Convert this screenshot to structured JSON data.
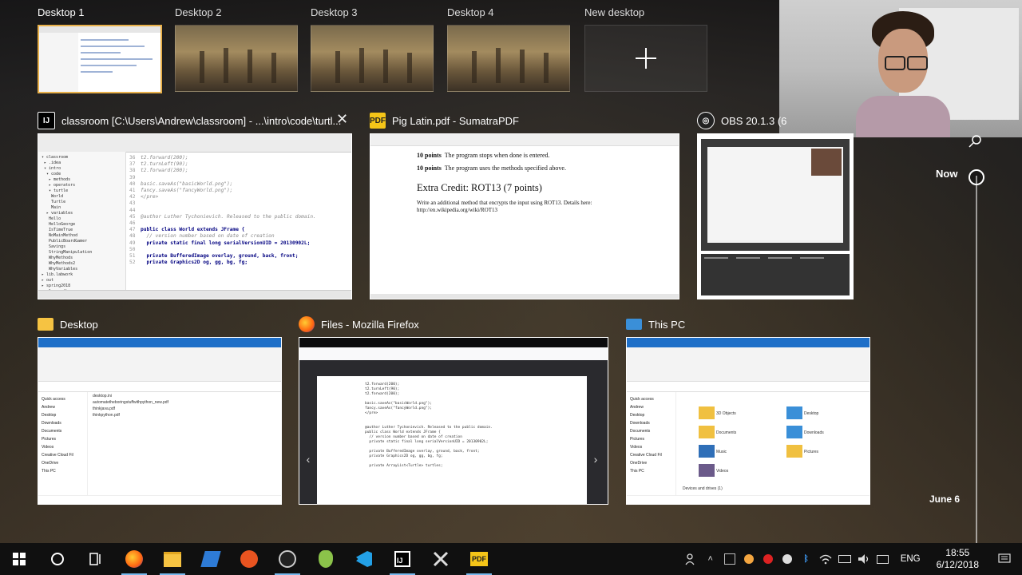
{
  "desktops": [
    {
      "label": "Desktop 1",
      "active": true
    },
    {
      "label": "Desktop 2",
      "active": false
    },
    {
      "label": "Desktop 3",
      "active": false
    },
    {
      "label": "Desktop 4",
      "active": false
    }
  ],
  "new_desktop": {
    "label": "New desktop"
  },
  "windows": {
    "ide": {
      "title": "classroom [C:\\Users\\Andrew\\classroom] - ...\\intro\\code\\turtl...",
      "icon": "intellij-icon",
      "code": {
        "line_numbers": [
          "36",
          "37",
          "38",
          "39",
          "40",
          "41",
          "42",
          "43",
          "44",
          "45",
          "46",
          "47",
          "48",
          "49",
          "50",
          "51",
          "52",
          "53"
        ],
        "lines": [
          "t2.forward(200);",
          "t2.turnLeft(90);",
          "t2.forward(200);",
          "",
          "basic.saveAs(\"basicWorld.png\");",
          "fancy.saveAs(\"fancyWorld.png\");",
          "</pre>",
          "",
          "",
          "@author Luther Tychonievich. Released to the public domain.",
          "",
          "public class World extends JFrame {",
          "  // version number based on date of creation",
          "  private static final long serialVersionUID = 20130902L;",
          "",
          "  private BufferedImage overlay, ground, back, front;",
          "  private Graphics2D og, gg, bg, fg;"
        ]
      }
    },
    "pdf": {
      "title": "Pig Latin.pdf - SumatraPDF",
      "icon": "sumatra-icon",
      "line1_pts": "10 points",
      "line1_text": "The program stops when done is entered.",
      "line2_pts": "10 points",
      "line2_text": "The program uses the methods specified above.",
      "heading": "Extra Credit: ROT13 (7 points)",
      "body": "Write an additional method that encrypts the input using ROT13. Details here: http://en.wikipedia.org/wiki/ROT13"
    },
    "obs": {
      "title": "OBS 20.1.3 (6",
      "icon": "obs-icon"
    },
    "desktop_explorer": {
      "title": "Desktop",
      "icon": "folder-icon",
      "nav": [
        "Quick access",
        "Andrew",
        "Desktop",
        "Downloads",
        "Documents",
        "Pictures",
        "Videos",
        "Creative Cloud Fil",
        "OneDrive",
        "This PC"
      ],
      "files": [
        "desktop.ini",
        "automatetheboringstuffwithpython_new.pdf",
        "thinkjava.pdf",
        "thinkpython.pdf"
      ]
    },
    "firefox": {
      "title": "Files - Mozilla Firefox",
      "icon": "firefox-icon",
      "code_lines": [
        "t2.forward(200);",
        "t2.turnLeft(90);",
        "t2.forward(200);",
        "",
        "basic.saveAs(\"basicWorld.png\");",
        "fancy.saveAs(\"fancyWorld.png\");",
        "</pre>",
        "",
        "",
        "@author Luther Tychonievich. Released to the public domain.",
        "public class World extends JFrame {",
        "  // version number based on date of creation",
        "  private static final long serialVersionUID = 20130902L;",
        "",
        "  private BufferedImage overlay, ground, back, front;",
        "  private Graphics2D og, gg, bg, fg;",
        "",
        "  private ArrayList<Turtle> turtles;"
      ]
    },
    "thispc": {
      "title": "This PC",
      "icon": "this-pc-icon",
      "nav": [
        "Quick access",
        "Andrew",
        "Desktop",
        "Downloads",
        "Documents",
        "Pictures",
        "Videos",
        "Creative Cloud Fil",
        "OneDrive",
        "This PC"
      ],
      "folders": [
        "3D Objects",
        "Desktop",
        "Documents",
        "Downloads",
        "Music",
        "Pictures",
        "Videos"
      ],
      "devices_header": "Devices and drives (1)"
    }
  },
  "timeline": {
    "now_label": "Now",
    "date_label": "June 6"
  },
  "taskbar": {
    "apps": [
      "windows-start-icon",
      "cortana-icon",
      "task-view-icon",
      "firefox-icon",
      "file-explorer-icon",
      "visual-studio-icon",
      "ubuntu-icon",
      "obs-icon",
      "android-studio-icon",
      "vscode-icon",
      "intellij-icon",
      "x-icon",
      "sumatra-icon"
    ],
    "language": "ENG",
    "time": "18:55",
    "date": "6/12/2018"
  },
  "colors": {
    "active_desktop_border": "#e8b04a",
    "taskbar_bg": "#101010",
    "accent": "#76b9ed"
  }
}
